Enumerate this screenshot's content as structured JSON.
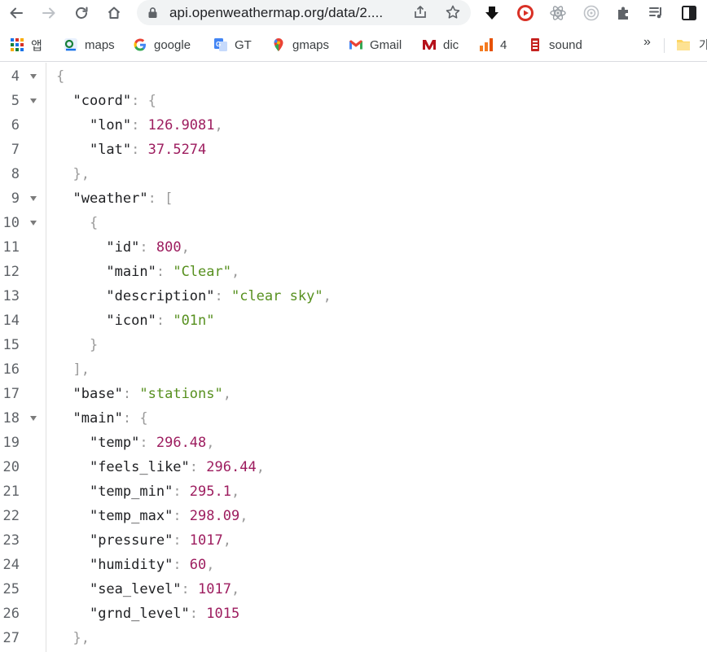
{
  "browser": {
    "url": "api.openweathermap.org/data/2....",
    "bookmarks": [
      {
        "label": "앱",
        "icon": "apps-grid-icon"
      },
      {
        "label": "maps",
        "icon": "maps-favicon"
      },
      {
        "label": "google",
        "icon": "google-favicon"
      },
      {
        "label": "GT",
        "icon": "translate-favicon"
      },
      {
        "label": "gmaps",
        "icon": "gmaps-pin-favicon"
      },
      {
        "label": "Gmail",
        "icon": "gmail-favicon"
      },
      {
        "label": "dic",
        "icon": "dictionary-favicon"
      },
      {
        "label": "4",
        "icon": "bars-favicon"
      },
      {
        "label": "sound",
        "icon": "sound-favicon"
      }
    ],
    "bookmarks_more": "»",
    "bookmark_folder_label": "가",
    "colors": {
      "accent": "#1a73e8",
      "number": "#9d1d5f",
      "string": "#57901f"
    }
  },
  "json_view": {
    "lines": [
      {
        "n": "4",
        "fold": true,
        "indent": "",
        "tokens": [
          {
            "t": "{",
            "c": "p"
          }
        ]
      },
      {
        "n": "5",
        "fold": true,
        "indent": "  ",
        "tokens": [
          {
            "t": "\"coord\"",
            "c": "k"
          },
          {
            "t": ": {",
            "c": "p"
          }
        ]
      },
      {
        "n": "6",
        "fold": false,
        "indent": "    ",
        "tokens": [
          {
            "t": "\"lon\"",
            "c": "k"
          },
          {
            "t": ": ",
            "c": "p"
          },
          {
            "t": "126.9081",
            "c": "n"
          },
          {
            "t": ",",
            "c": "p"
          }
        ]
      },
      {
        "n": "7",
        "fold": false,
        "indent": "    ",
        "tokens": [
          {
            "t": "\"lat\"",
            "c": "k"
          },
          {
            "t": ": ",
            "c": "p"
          },
          {
            "t": "37.5274",
            "c": "n"
          }
        ]
      },
      {
        "n": "8",
        "fold": false,
        "indent": "  ",
        "tokens": [
          {
            "t": "},",
            "c": "p"
          }
        ]
      },
      {
        "n": "9",
        "fold": true,
        "indent": "  ",
        "tokens": [
          {
            "t": "\"weather\"",
            "c": "k"
          },
          {
            "t": ": [",
            "c": "p"
          }
        ]
      },
      {
        "n": "10",
        "fold": true,
        "indent": "    ",
        "tokens": [
          {
            "t": "{",
            "c": "p"
          }
        ]
      },
      {
        "n": "11",
        "fold": false,
        "indent": "      ",
        "tokens": [
          {
            "t": "\"id\"",
            "c": "k"
          },
          {
            "t": ": ",
            "c": "p"
          },
          {
            "t": "800",
            "c": "n"
          },
          {
            "t": ",",
            "c": "p"
          }
        ]
      },
      {
        "n": "12",
        "fold": false,
        "indent": "      ",
        "tokens": [
          {
            "t": "\"main\"",
            "c": "k"
          },
          {
            "t": ": ",
            "c": "p"
          },
          {
            "t": "\"Clear\"",
            "c": "s"
          },
          {
            "t": ",",
            "c": "p"
          }
        ]
      },
      {
        "n": "13",
        "fold": false,
        "indent": "      ",
        "tokens": [
          {
            "t": "\"description\"",
            "c": "k"
          },
          {
            "t": ": ",
            "c": "p"
          },
          {
            "t": "\"clear sky\"",
            "c": "s"
          },
          {
            "t": ",",
            "c": "p"
          }
        ]
      },
      {
        "n": "14",
        "fold": false,
        "indent": "      ",
        "tokens": [
          {
            "t": "\"icon\"",
            "c": "k"
          },
          {
            "t": ": ",
            "c": "p"
          },
          {
            "t": "\"01n\"",
            "c": "s"
          }
        ]
      },
      {
        "n": "15",
        "fold": false,
        "indent": "    ",
        "tokens": [
          {
            "t": "}",
            "c": "p"
          }
        ]
      },
      {
        "n": "16",
        "fold": false,
        "indent": "  ",
        "tokens": [
          {
            "t": "],",
            "c": "p"
          }
        ]
      },
      {
        "n": "17",
        "fold": false,
        "indent": "  ",
        "tokens": [
          {
            "t": "\"base\"",
            "c": "k"
          },
          {
            "t": ": ",
            "c": "p"
          },
          {
            "t": "\"stations\"",
            "c": "s"
          },
          {
            "t": ",",
            "c": "p"
          }
        ]
      },
      {
        "n": "18",
        "fold": true,
        "indent": "  ",
        "tokens": [
          {
            "t": "\"main\"",
            "c": "k"
          },
          {
            "t": ": {",
            "c": "p"
          }
        ]
      },
      {
        "n": "19",
        "fold": false,
        "indent": "    ",
        "tokens": [
          {
            "t": "\"temp\"",
            "c": "k"
          },
          {
            "t": ": ",
            "c": "p"
          },
          {
            "t": "296.48",
            "c": "n"
          },
          {
            "t": ",",
            "c": "p"
          }
        ]
      },
      {
        "n": "20",
        "fold": false,
        "indent": "    ",
        "tokens": [
          {
            "t": "\"feels_like\"",
            "c": "k"
          },
          {
            "t": ": ",
            "c": "p"
          },
          {
            "t": "296.44",
            "c": "n"
          },
          {
            "t": ",",
            "c": "p"
          }
        ]
      },
      {
        "n": "21",
        "fold": false,
        "indent": "    ",
        "tokens": [
          {
            "t": "\"temp_min\"",
            "c": "k"
          },
          {
            "t": ": ",
            "c": "p"
          },
          {
            "t": "295.1",
            "c": "n"
          },
          {
            "t": ",",
            "c": "p"
          }
        ]
      },
      {
        "n": "22",
        "fold": false,
        "indent": "    ",
        "tokens": [
          {
            "t": "\"temp_max\"",
            "c": "k"
          },
          {
            "t": ": ",
            "c": "p"
          },
          {
            "t": "298.09",
            "c": "n"
          },
          {
            "t": ",",
            "c": "p"
          }
        ]
      },
      {
        "n": "23",
        "fold": false,
        "indent": "    ",
        "tokens": [
          {
            "t": "\"pressure\"",
            "c": "k"
          },
          {
            "t": ": ",
            "c": "p"
          },
          {
            "t": "1017",
            "c": "n"
          },
          {
            "t": ",",
            "c": "p"
          }
        ]
      },
      {
        "n": "24",
        "fold": false,
        "indent": "    ",
        "tokens": [
          {
            "t": "\"humidity\"",
            "c": "k"
          },
          {
            "t": ": ",
            "c": "p"
          },
          {
            "t": "60",
            "c": "n"
          },
          {
            "t": ",",
            "c": "p"
          }
        ]
      },
      {
        "n": "25",
        "fold": false,
        "indent": "    ",
        "tokens": [
          {
            "t": "\"sea_level\"",
            "c": "k"
          },
          {
            "t": ": ",
            "c": "p"
          },
          {
            "t": "1017",
            "c": "n"
          },
          {
            "t": ",",
            "c": "p"
          }
        ]
      },
      {
        "n": "26",
        "fold": false,
        "indent": "    ",
        "tokens": [
          {
            "t": "\"grnd_level\"",
            "c": "k"
          },
          {
            "t": ": ",
            "c": "p"
          },
          {
            "t": "1015",
            "c": "n"
          }
        ]
      },
      {
        "n": "27",
        "fold": false,
        "indent": "  ",
        "tokens": [
          {
            "t": "},",
            "c": "p"
          }
        ]
      }
    ]
  }
}
